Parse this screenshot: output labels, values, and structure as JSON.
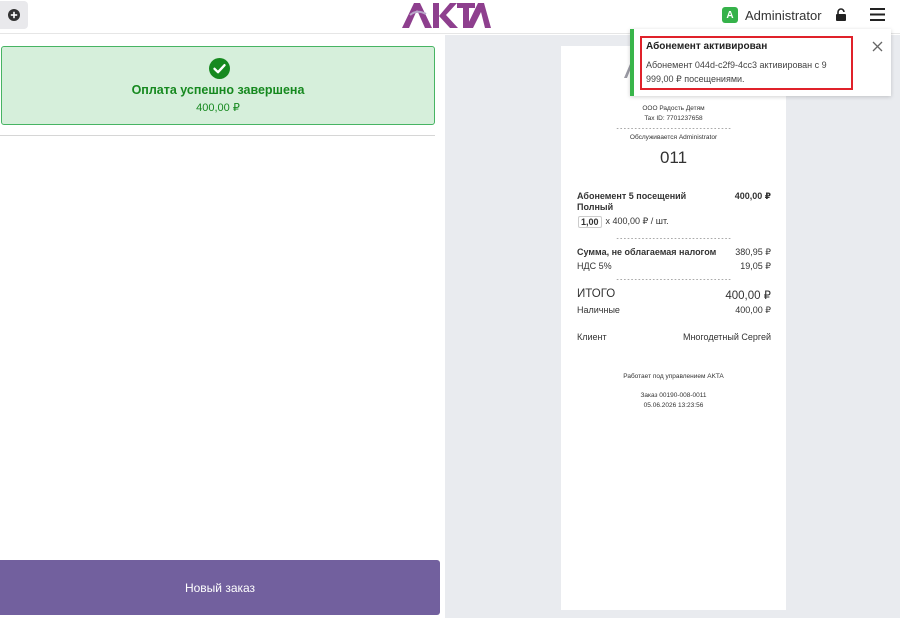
{
  "header": {
    "logo_text": "AKTA",
    "user_initial": "A",
    "user_name": "Administrator",
    "icons": [
      "plus-circle-icon",
      "lock-icon",
      "hamburger-menu-icon"
    ]
  },
  "payment": {
    "title": "Оплата успешно завершена",
    "amount": "400,00 ₽",
    "status_color": "#16891f"
  },
  "actions": {
    "new_order_label": "Новый заказ",
    "accent_color": "#72609e"
  },
  "receipt": {
    "company": "ООО Радость Детям",
    "tax_id": "Tax ID: 7701237658",
    "served_by": "Обслуживается Administrator",
    "ticket_number": "011",
    "item_name": "Абонемент 5 посещений",
    "item_variant": "Полный",
    "item_price": "400,00 ₽",
    "item_qty": "1,00",
    "item_unit": "x 400,00 ₽ / шт.",
    "untaxed_label": "Сумма, не облагаемая налогом",
    "untaxed_value": "380,95 ₽",
    "vat_label": "НДС 5%",
    "vat_value": "19,05 ₽",
    "total_label": "ИТОГО",
    "total_value": "400,00 ₽",
    "cash_label": "Наличные",
    "cash_value": "400,00 ₽",
    "client_label": "Клиент",
    "client_value": "Многодетный Сергей",
    "powered_by": "Работает под управлением AKTA",
    "order_number": "Заказ 00190-008-0011",
    "order_datetime": "05.06.2026 13:23:56",
    "separator": "--------------------------------"
  },
  "notification": {
    "title": "Абонемент активирован",
    "message": "Абонемент 044d-c2f9-4cc3 активирован с 9 999,00 ₽ посещениями.",
    "accent_color": "#39b54a",
    "highlight_color": "#e0212a"
  }
}
